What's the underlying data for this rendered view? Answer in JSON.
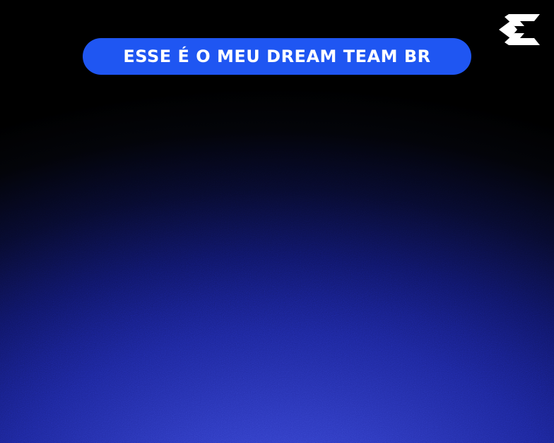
{
  "header": {
    "title": "ESSE É O MEU DREAM TEAM BR"
  },
  "brand": {
    "logo_icon": "brand-logo-icon",
    "logo_color": "#ffffff"
  },
  "colors": {
    "pill_background": "#1f56f2",
    "background_top": "#000000",
    "background_bottom": "#3a47d8"
  }
}
